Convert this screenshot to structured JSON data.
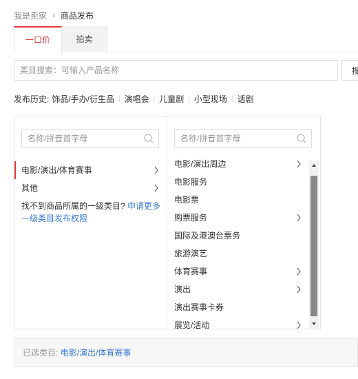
{
  "breadcrumb": {
    "parent": "我是卖家",
    "separator": "›",
    "current": "商品发布"
  },
  "tabs": [
    {
      "label": "一口价",
      "active": true
    },
    {
      "label": "拍卖",
      "active": false
    }
  ],
  "category_search": {
    "placeholder": "类目搜索：可输入产品名称",
    "button_label": "搜索"
  },
  "history": {
    "label": "发布历史:",
    "items": [
      "饰品/手办/衍生品",
      "演唱会",
      "儿童剧",
      "小型现场",
      "话剧"
    ]
  },
  "column1": {
    "search_placeholder": "名称/拼音首字母",
    "items": [
      {
        "label": "电影/演出/体育赛事",
        "has_children": true,
        "selected": true
      },
      {
        "label": "其他",
        "has_children": true,
        "selected": false
      }
    ],
    "help_text": "找不到商品所属的一级类目?",
    "help_link": "申请更多一级类目发布权限"
  },
  "column2": {
    "search_placeholder": "名称/拼音首字母",
    "items": [
      {
        "label": "电影/演出周边",
        "has_children": true
      },
      {
        "label": "电影服务",
        "has_children": false
      },
      {
        "label": "电影票",
        "has_children": false
      },
      {
        "label": "购票服务",
        "has_children": true
      },
      {
        "label": "国际及港澳台票务",
        "has_children": false
      },
      {
        "label": "旅游演艺",
        "has_children": false
      },
      {
        "label": "体育赛事",
        "has_children": true
      },
      {
        "label": "演出",
        "has_children": true
      },
      {
        "label": "演出赛事卡券",
        "has_children": false
      },
      {
        "label": "展览/活动",
        "has_children": true
      }
    ]
  },
  "selected_category": {
    "label": "已选类目:",
    "value": "电影/演出/体育赛事"
  },
  "colors": {
    "accent": "#e4393c",
    "link": "#3a7bd5",
    "border": "#e5e5e5"
  },
  "icons": {
    "search": "magnifier-icon",
    "chevron": "chevron-right-icon",
    "scroll_up": "triangle-up-icon",
    "scroll_down": "triangle-down-icon"
  }
}
